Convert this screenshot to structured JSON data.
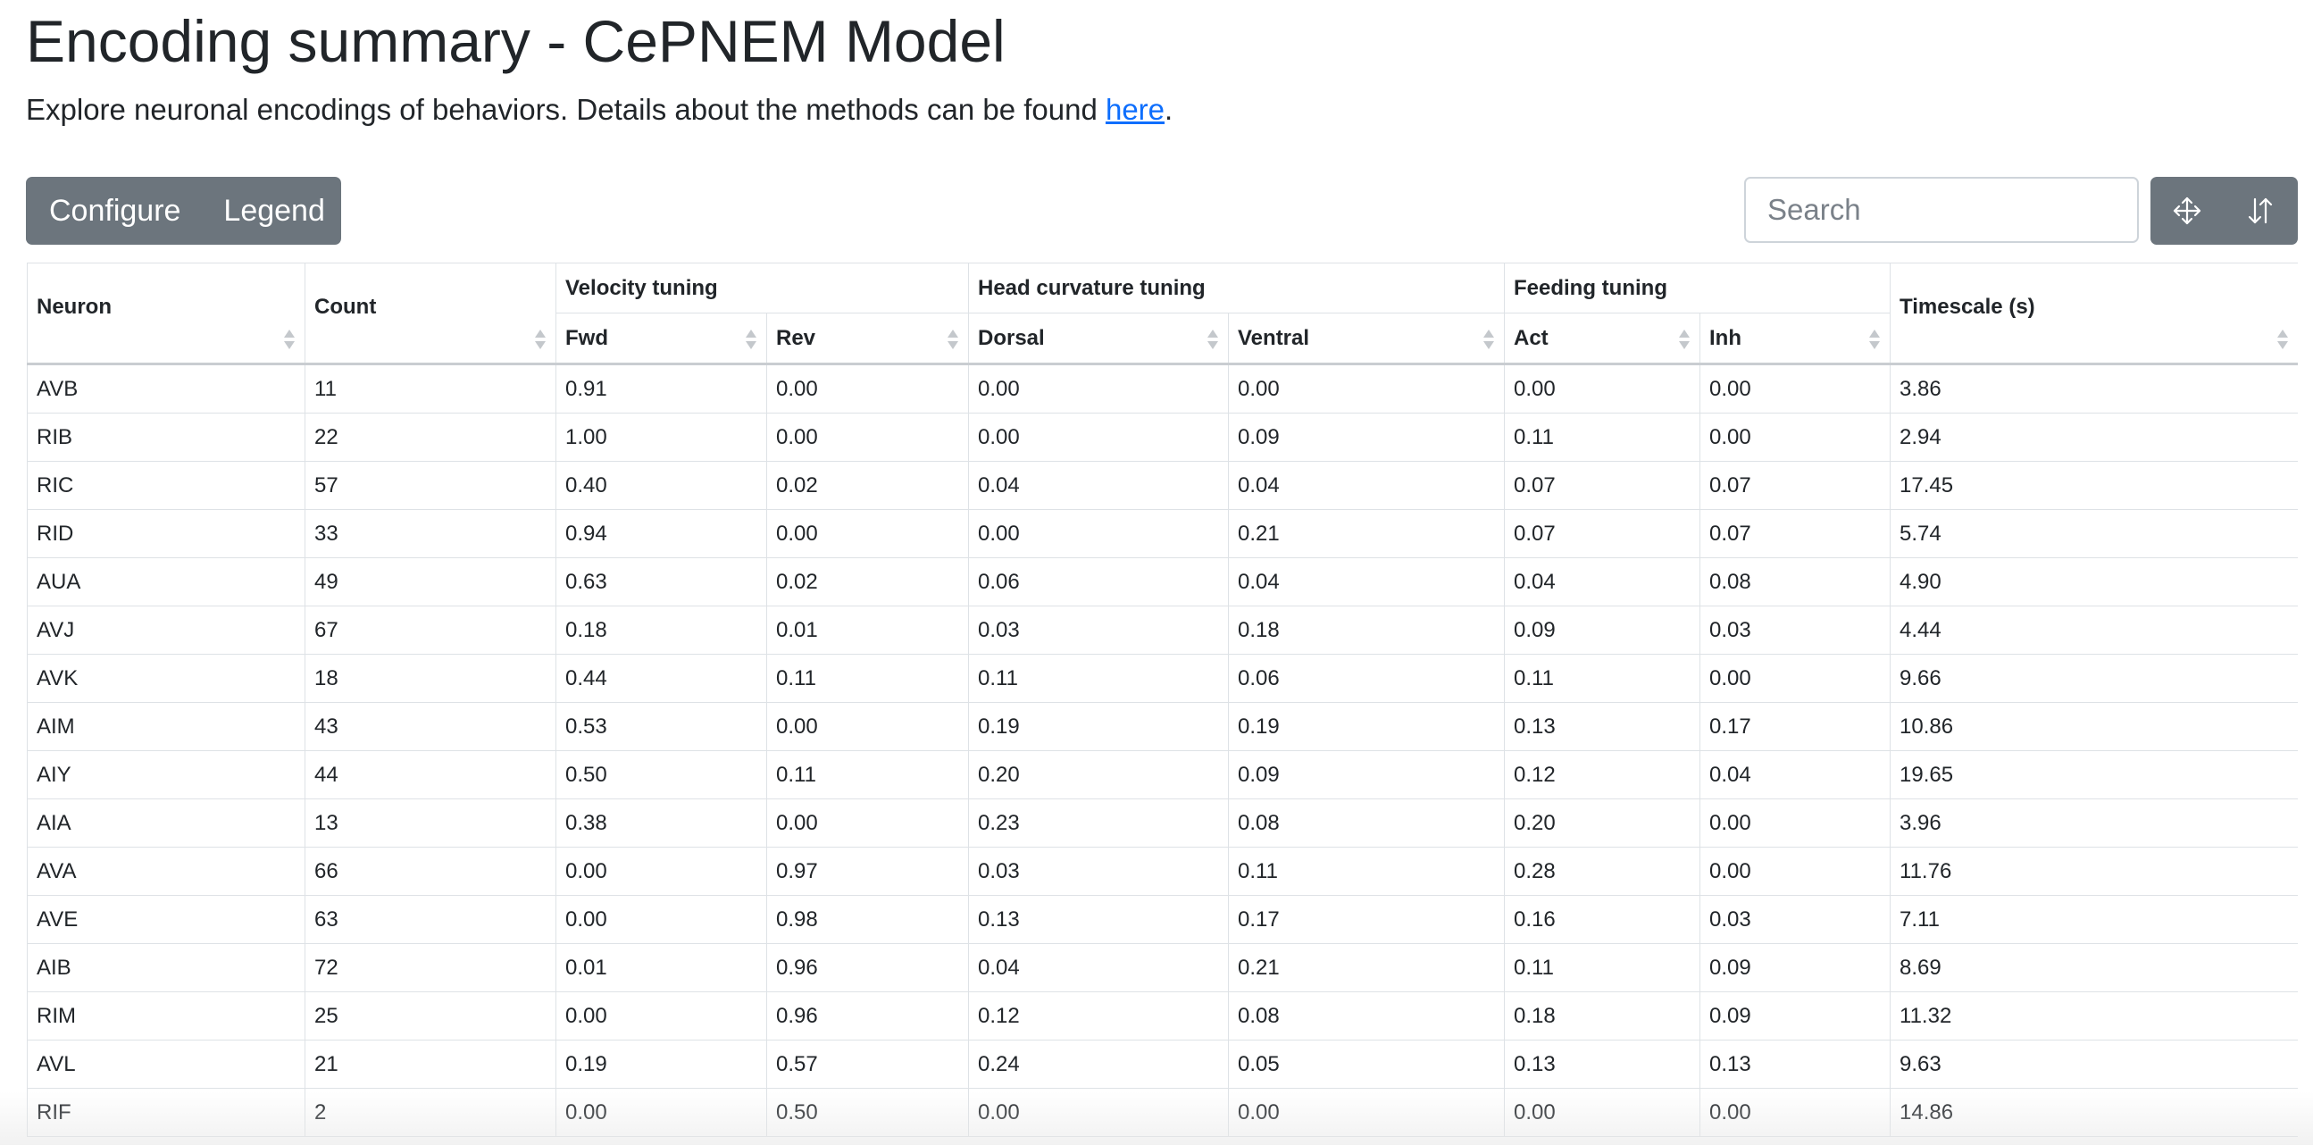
{
  "header": {
    "title": "Encoding summary - CePNEM Model",
    "subtitle_before_link": "Explore neuronal encodings of behaviors. Details about the methods can be found ",
    "subtitle_link": "here",
    "subtitle_after_link": "."
  },
  "toolbar": {
    "configure_label": "Configure",
    "legend_label": "Legend",
    "search_placeholder": "Search",
    "search_value": "",
    "icons": [
      "move-icon",
      "sort-arrows-icon"
    ]
  },
  "table": {
    "group_headers": {
      "velocity": "Velocity tuning",
      "head": "Head curvature tuning",
      "feeding": "Feeding tuning"
    },
    "columns": {
      "neuron": "Neuron",
      "count": "Count",
      "fwd": "Fwd",
      "rev": "Rev",
      "dorsal": "Dorsal",
      "ventral": "Ventral",
      "act": "Act",
      "inh": "Inh",
      "timescale": "Timescale (s)"
    },
    "rows": [
      [
        "AVB",
        "11",
        "0.91",
        "0.00",
        "0.00",
        "0.00",
        "0.00",
        "0.00",
        "3.86"
      ],
      [
        "RIB",
        "22",
        "1.00",
        "0.00",
        "0.00",
        "0.09",
        "0.11",
        "0.00",
        "2.94"
      ],
      [
        "RIC",
        "57",
        "0.40",
        "0.02",
        "0.04",
        "0.04",
        "0.07",
        "0.07",
        "17.45"
      ],
      [
        "RID",
        "33",
        "0.94",
        "0.00",
        "0.00",
        "0.21",
        "0.07",
        "0.07",
        "5.74"
      ],
      [
        "AUA",
        "49",
        "0.63",
        "0.02",
        "0.06",
        "0.04",
        "0.04",
        "0.08",
        "4.90"
      ],
      [
        "AVJ",
        "67",
        "0.18",
        "0.01",
        "0.03",
        "0.18",
        "0.09",
        "0.03",
        "4.44"
      ],
      [
        "AVK",
        "18",
        "0.44",
        "0.11",
        "0.11",
        "0.06",
        "0.11",
        "0.00",
        "9.66"
      ],
      [
        "AIM",
        "43",
        "0.53",
        "0.00",
        "0.19",
        "0.19",
        "0.13",
        "0.17",
        "10.86"
      ],
      [
        "AIY",
        "44",
        "0.50",
        "0.11",
        "0.20",
        "0.09",
        "0.12",
        "0.04",
        "19.65"
      ],
      [
        "AIA",
        "13",
        "0.38",
        "0.00",
        "0.23",
        "0.08",
        "0.20",
        "0.00",
        "3.96"
      ],
      [
        "AVA",
        "66",
        "0.00",
        "0.97",
        "0.03",
        "0.11",
        "0.28",
        "0.00",
        "11.76"
      ],
      [
        "AVE",
        "63",
        "0.00",
        "0.98",
        "0.13",
        "0.17",
        "0.16",
        "0.03",
        "7.11"
      ],
      [
        "AIB",
        "72",
        "0.01",
        "0.96",
        "0.04",
        "0.21",
        "0.11",
        "0.09",
        "8.69"
      ],
      [
        "RIM",
        "25",
        "0.00",
        "0.96",
        "0.12",
        "0.08",
        "0.18",
        "0.09",
        "11.32"
      ],
      [
        "AVL",
        "21",
        "0.19",
        "0.57",
        "0.24",
        "0.05",
        "0.13",
        "0.13",
        "9.63"
      ],
      [
        "RIF",
        "2",
        "0.00",
        "0.50",
        "0.00",
        "0.00",
        "0.00",
        "0.00",
        "14.86"
      ]
    ]
  }
}
